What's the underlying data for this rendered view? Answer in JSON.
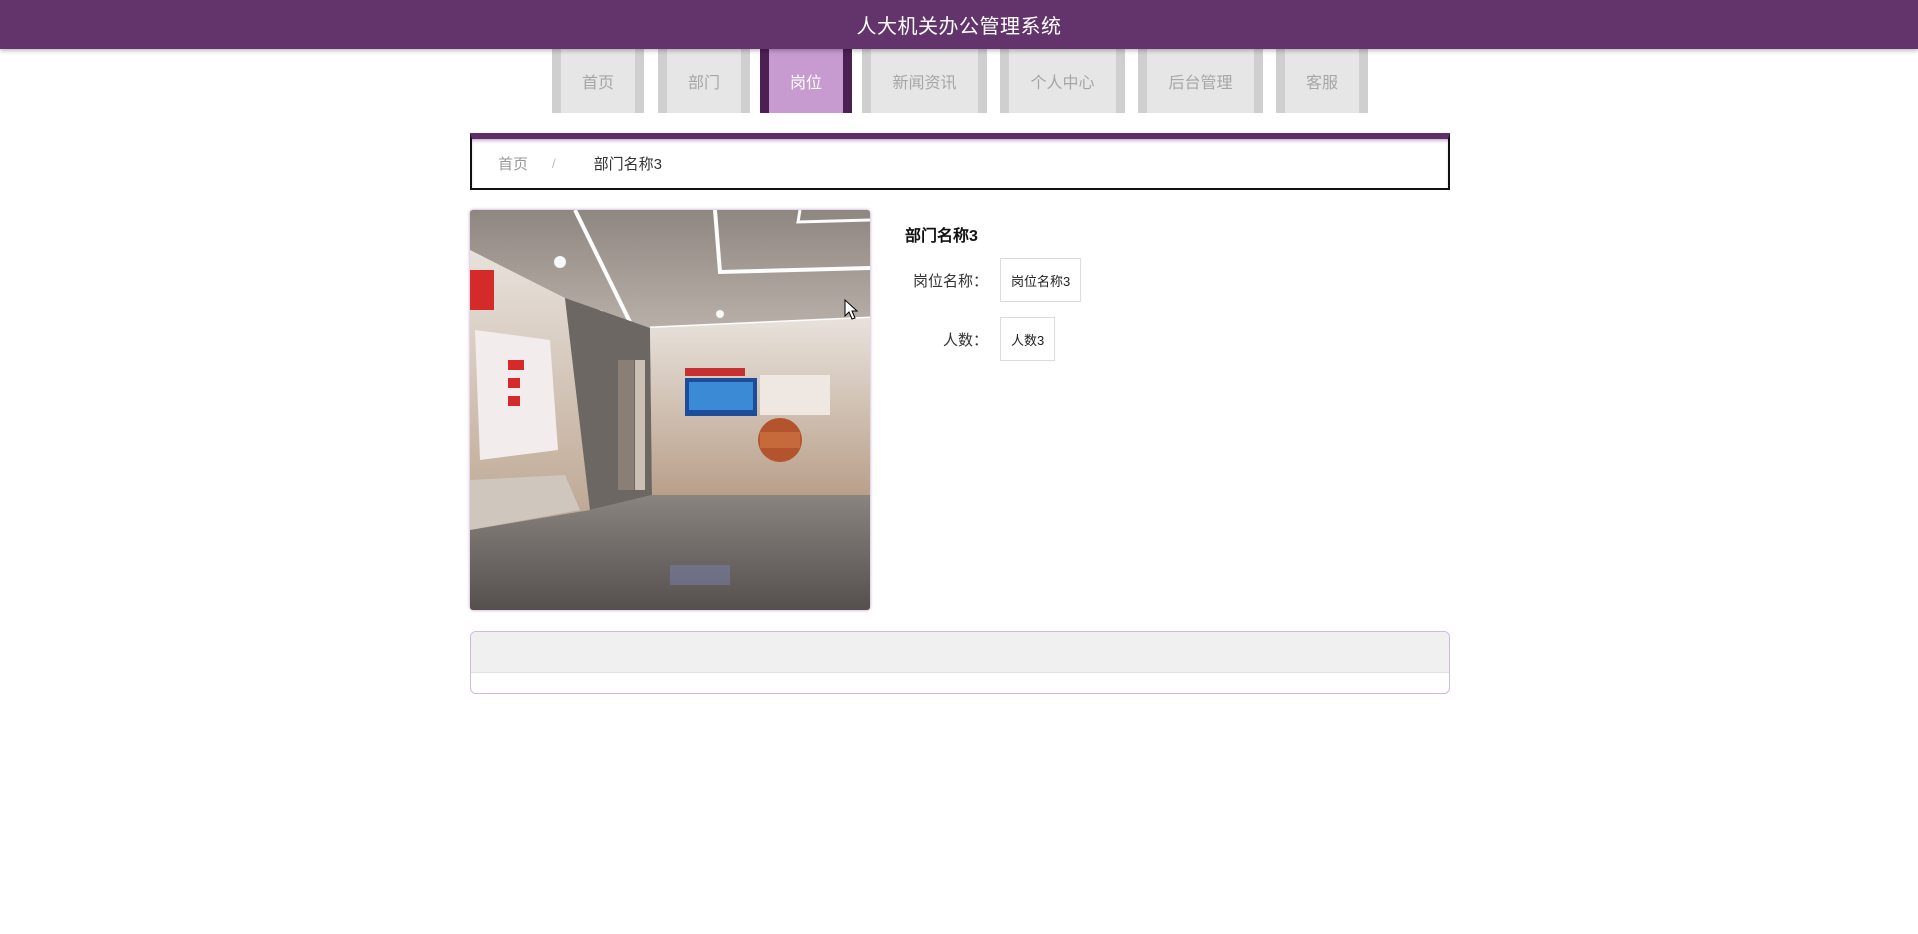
{
  "header": {
    "title": "人大机关办公管理系统"
  },
  "nav": {
    "items": [
      {
        "label": "首页",
        "active": false
      },
      {
        "label": "部门",
        "active": false
      },
      {
        "label": "岗位",
        "active": true
      },
      {
        "label": "新闻资讯",
        "active": false
      },
      {
        "label": "个人中心",
        "active": false
      },
      {
        "label": "后台管理",
        "active": false
      },
      {
        "label": "客服",
        "active": false
      }
    ]
  },
  "breadcrumb": {
    "home": "首页",
    "separator": "/",
    "current": "部门名称3"
  },
  "detail": {
    "title": "部门名称3",
    "fields": [
      {
        "label": "岗位名称：",
        "value": "岗位名称3"
      },
      {
        "label": "人数：",
        "value": "人数3"
      }
    ]
  },
  "colors": {
    "header_bg": "#63336b",
    "nav_active_bg": "#c79bd0",
    "nav_active_border": "#4c1f55",
    "nav_bg": "#e6e6e6",
    "nav_border": "#cfcfcf"
  }
}
